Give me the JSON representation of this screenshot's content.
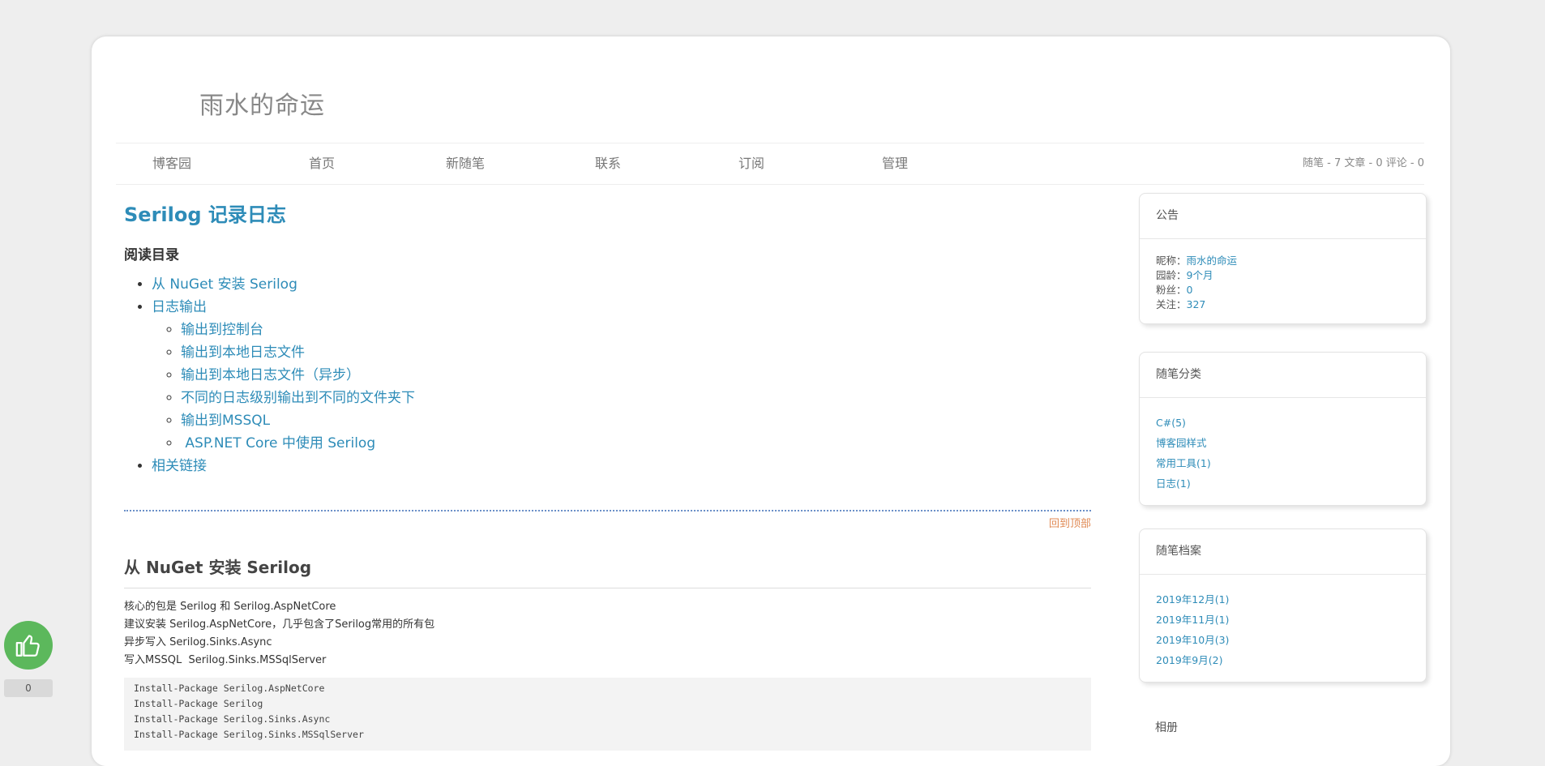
{
  "blog": {
    "title": "雨水的命运"
  },
  "nav": {
    "items": [
      "博客园",
      "首页",
      "新随笔",
      "联系",
      "订阅",
      "管理"
    ],
    "stats": "随笔 - 7  文章 - 0  评论 - 0"
  },
  "post": {
    "title": "Serilog 记录日志",
    "toc_heading": "阅读目录",
    "toc": {
      "item1": "从 NuGet 安装 Serilog",
      "item2": "日志输出",
      "sub": [
        "输出到控制台",
        "输出到本地日志文件",
        "输出到本地日志文件（异步）",
        "不同的日志级别输出到不同的文件夹下",
        "输出到MSSQL",
        " ASP.NET Core 中使用 Serilog"
      ],
      "item3": "相关链接"
    },
    "back_to_top": "回到顶部",
    "section_title": "从 NuGet 安装 Serilog",
    "paragraphs": [
      "核心的包是 Serilog 和 Serilog.AspNetCore",
      "建议安装 Serilog.AspNetCore，几乎包含了Serilog常用的所有包",
      "异步写入 Serilog.Sinks.Async",
      "写入MSSQL  Serilog.Sinks.MSSqlServer"
    ],
    "code": [
      "Install-Package Serilog.AspNetCore",
      "Install-Package Serilog",
      "Install-Package Serilog.Sinks.Async",
      "Install-Package Serilog.Sinks.MSSqlServer"
    ]
  },
  "sidebar": {
    "notice": {
      "title": "公告",
      "rows": [
        {
          "label": "昵称：",
          "value": "雨水的命运"
        },
        {
          "label": "园龄：",
          "value": "9个月"
        },
        {
          "label": "粉丝：",
          "value": "0"
        },
        {
          "label": "关注：",
          "value": "327"
        }
      ]
    },
    "categories": {
      "title": "随笔分类",
      "items": [
        "C#(5)",
        "博客园样式",
        "常用工具(1)",
        "日志(1)"
      ]
    },
    "archive": {
      "title": "随笔档案",
      "items": [
        "2019年12月(1)",
        "2019年11月(1)",
        "2019年10月(3)",
        "2019年9月(2)"
      ]
    },
    "album": {
      "title": "相册"
    }
  },
  "like": {
    "icon": "thumbs-up-icon",
    "count": "0",
    "color": "#5cb85c"
  }
}
